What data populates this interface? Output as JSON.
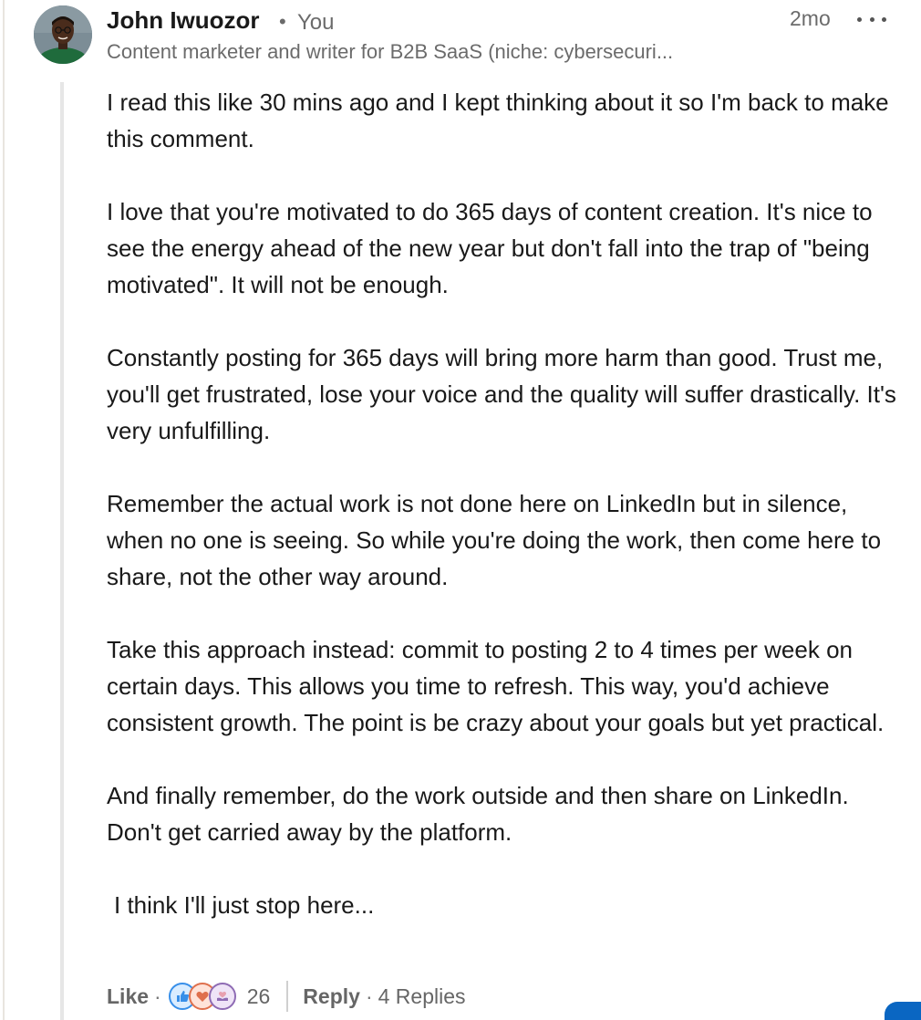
{
  "comment": {
    "author": {
      "name": "John Iwuozor",
      "separator": "•",
      "relation": "You",
      "headline": "Content marketer and writer for B2B SaaS (niche: cybersecuri..."
    },
    "timestamp": "2mo",
    "more_icon": "ellipsis-horizontal-icon",
    "paragraphs": [
      "I read this like 30 mins ago and I kept thinking about it so I'm back to make this comment.",
      "I love that you're motivated to do 365 days of content creation. It's nice to see the energy ahead of the new year but don't fall into the trap of \"being motivated\". It will not be enough.",
      "Constantly posting for 365 days will bring more harm than good. Trust me, you'll get frustrated, lose your voice and the quality will suffer drastically. It's very unfulfilling.",
      "Remember the actual work is not done here on LinkedIn but in silence, when no one is seeing. So while you're doing the work, then come here to share, not the other way around.",
      "Take this approach instead: commit to posting 2 to 4 times per week on certain days. This allows you time to refresh. This way, you'd achieve consistent growth. The point is be crazy about your goals but yet practical.",
      "And finally remember, do the work outside and then share on LinkedIn. Don't get carried away by the platform.",
      "I think I'll just stop here..."
    ],
    "actions": {
      "like_label": "Like",
      "dot": "·",
      "reaction_icons": [
        "like-reaction-icon",
        "love-reaction-icon",
        "support-reaction-icon"
      ],
      "reaction_count": "26",
      "reply_label": "Reply",
      "replies_label": "4 Replies"
    }
  },
  "colors": {
    "like_reaction": "#378fe9",
    "love_reaction": "#df704d",
    "support_reaction": "#8e6bb4",
    "linkedin_blue": "#0a66c2"
  }
}
